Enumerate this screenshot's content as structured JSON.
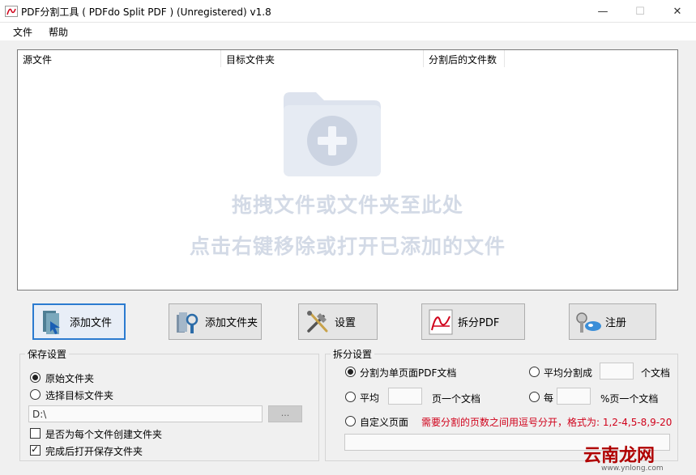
{
  "window": {
    "title": "PDF分割工具 ( PDFdo Split PDF ) (Unregistered) v1.8",
    "minimize": "—",
    "maximize": "☐",
    "close": "✕"
  },
  "menu": [
    "文件",
    "帮助"
  ],
  "list": {
    "columns": [
      "源文件",
      "目标文件夹",
      "分割后的文件数"
    ],
    "hint_line1": "拖拽文件或文件夹至此处",
    "hint_line2": "点击右键移除或打开已添加的文件"
  },
  "toolbar": {
    "add_file": "添加文件",
    "add_folder": "添加文件夹",
    "settings": "设置",
    "split_pdf": "拆分PDF",
    "register": "注册"
  },
  "save_settings": {
    "title": "保存设置",
    "original_folder": "原始文件夹",
    "choose_folder": "选择目标文件夹",
    "path_value": "D:\\",
    "browse": "...",
    "create_folder_each": "是否为每个文件创建文件夹",
    "open_after": "完成后打开保存文件夹",
    "original_folder_selected": true,
    "open_after_checked": true,
    "create_folder_each_checked": false
  },
  "split_settings": {
    "title": "拆分设置",
    "single_page": "分割为单页面PDF文档",
    "avg_split_into": "平均分割成",
    "docs_suffix": "个文档",
    "avg": "平均",
    "page_per_doc": "页一个文档",
    "every": "每",
    "percent_page_per_doc": "%页一个文档",
    "custom_pages": "自定义页面",
    "custom_hint": "需要分割的页数之间用逗号分开，格式为: 1,2-4,5-8,9-20"
  },
  "watermark": {
    "brand": "云南龙网",
    "url": "www.ynlong.com"
  }
}
